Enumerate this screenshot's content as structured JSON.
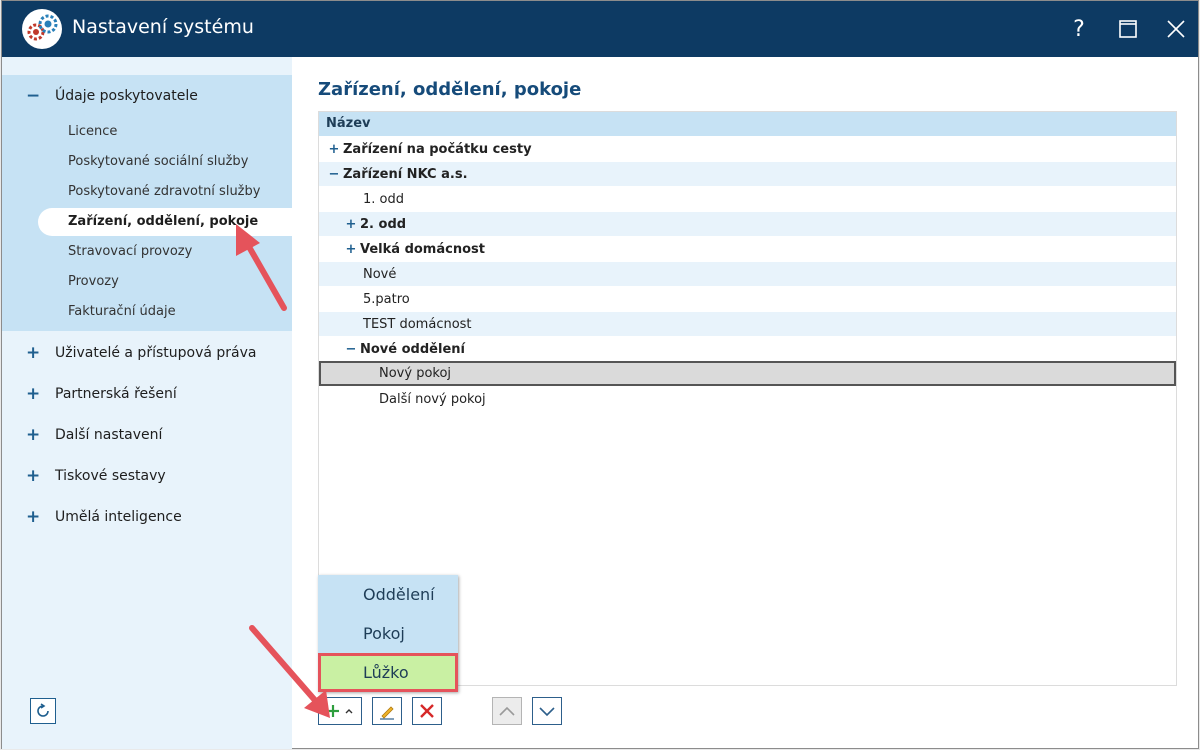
{
  "window": {
    "title": "Nastavení systému"
  },
  "title_buttons": {
    "help": "?"
  },
  "sidebar": {
    "expanded_group": "Údaje poskytovatele",
    "sub_items": [
      "Licence",
      "Poskytované sociální služby",
      "Poskytované zdravotní služby",
      "Zařízení, oddělení, pokoje",
      "Stravovací provozy",
      "Provozy",
      "Fakturační údaje"
    ],
    "active_index": 3,
    "collapsed_groups": [
      "Uživatelé a přístupová práva",
      "Partnerská řešení",
      "Další nastavení",
      "Tiskové sestavy",
      "Umělá inteligence"
    ]
  },
  "main": {
    "title": "Zařízení, oddělení, pokoje",
    "column_header": "Název",
    "rows": [
      {
        "label": "Zařízení na počátku cesty",
        "toggle": "+"
      },
      {
        "label": "Zařízení NKC a.s.",
        "toggle": "−"
      },
      {
        "label": "1. odd",
        "toggle": ""
      },
      {
        "label": "2. odd",
        "toggle": "+"
      },
      {
        "label": "Velká domácnost",
        "toggle": "+"
      },
      {
        "label": "Nové",
        "toggle": ""
      },
      {
        "label": "5.patro",
        "toggle": ""
      },
      {
        "label": "TEST domácnost",
        "toggle": ""
      },
      {
        "label": "Nové oddělení",
        "toggle": "−"
      },
      {
        "label": "Nový pokoj",
        "toggle": ""
      },
      {
        "label": "Další nový pokoj",
        "toggle": ""
      }
    ],
    "selected_row": "Nový pokoj"
  },
  "popup_menu": {
    "items": [
      "Oddělení",
      "Pokoj",
      "Lůžko"
    ],
    "highlighted": "Lůžko"
  },
  "toolbar": {
    "add_icon": "plus-icon",
    "edit_icon": "pencil-icon",
    "delete_icon": "close-icon",
    "up_icon": "chevron-up-icon",
    "down_icon": "chevron-down-icon"
  },
  "colors": {
    "titlebar": "#0d3a63",
    "sidebar_bg": "#e8f3fb",
    "sidebar_expanded_bg": "#c6e2f4",
    "accent_text": "#164b7a",
    "highlight_green": "#c9f0a3",
    "annotation_red": "#e5535b"
  }
}
